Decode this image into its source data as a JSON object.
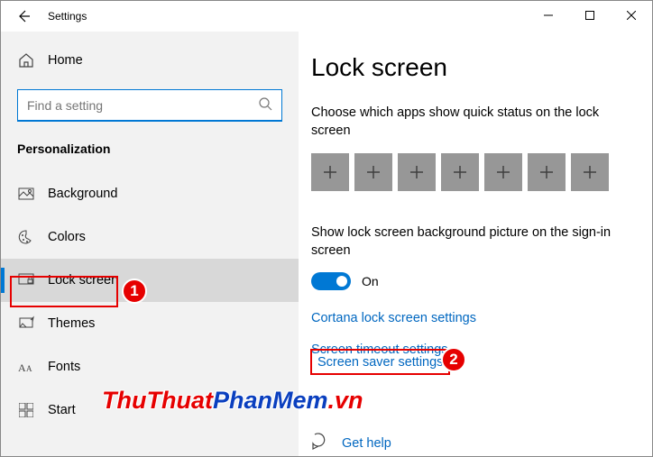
{
  "window": {
    "title": "Settings"
  },
  "sidebar": {
    "home": "Home",
    "search_placeholder": "Find a setting",
    "section": "Personalization",
    "items": [
      {
        "label": "Background"
      },
      {
        "label": "Colors"
      },
      {
        "label": "Lock screen",
        "selected": true
      },
      {
        "label": "Themes"
      },
      {
        "label": "Fonts"
      },
      {
        "label": "Start"
      }
    ]
  },
  "main": {
    "heading": "Lock screen",
    "quick_status_text": "Choose which apps show quick status on the lock screen",
    "quick_status_slots": 7,
    "signin_bg_text": "Show lock screen background picture on the sign-in screen",
    "signin_bg_toggle": {
      "state": "On",
      "value": true
    },
    "link_cortana": "Cortana lock screen settings",
    "link_timeout": "Screen timeout settings",
    "link_screensaver": "Screen saver settings",
    "help": "Get help"
  },
  "annotations": {
    "callout1": "1",
    "callout2": "2",
    "watermark_part1": "ThuThuat",
    "watermark_part2": "PhanMem",
    "watermark_part3": ".vn"
  }
}
